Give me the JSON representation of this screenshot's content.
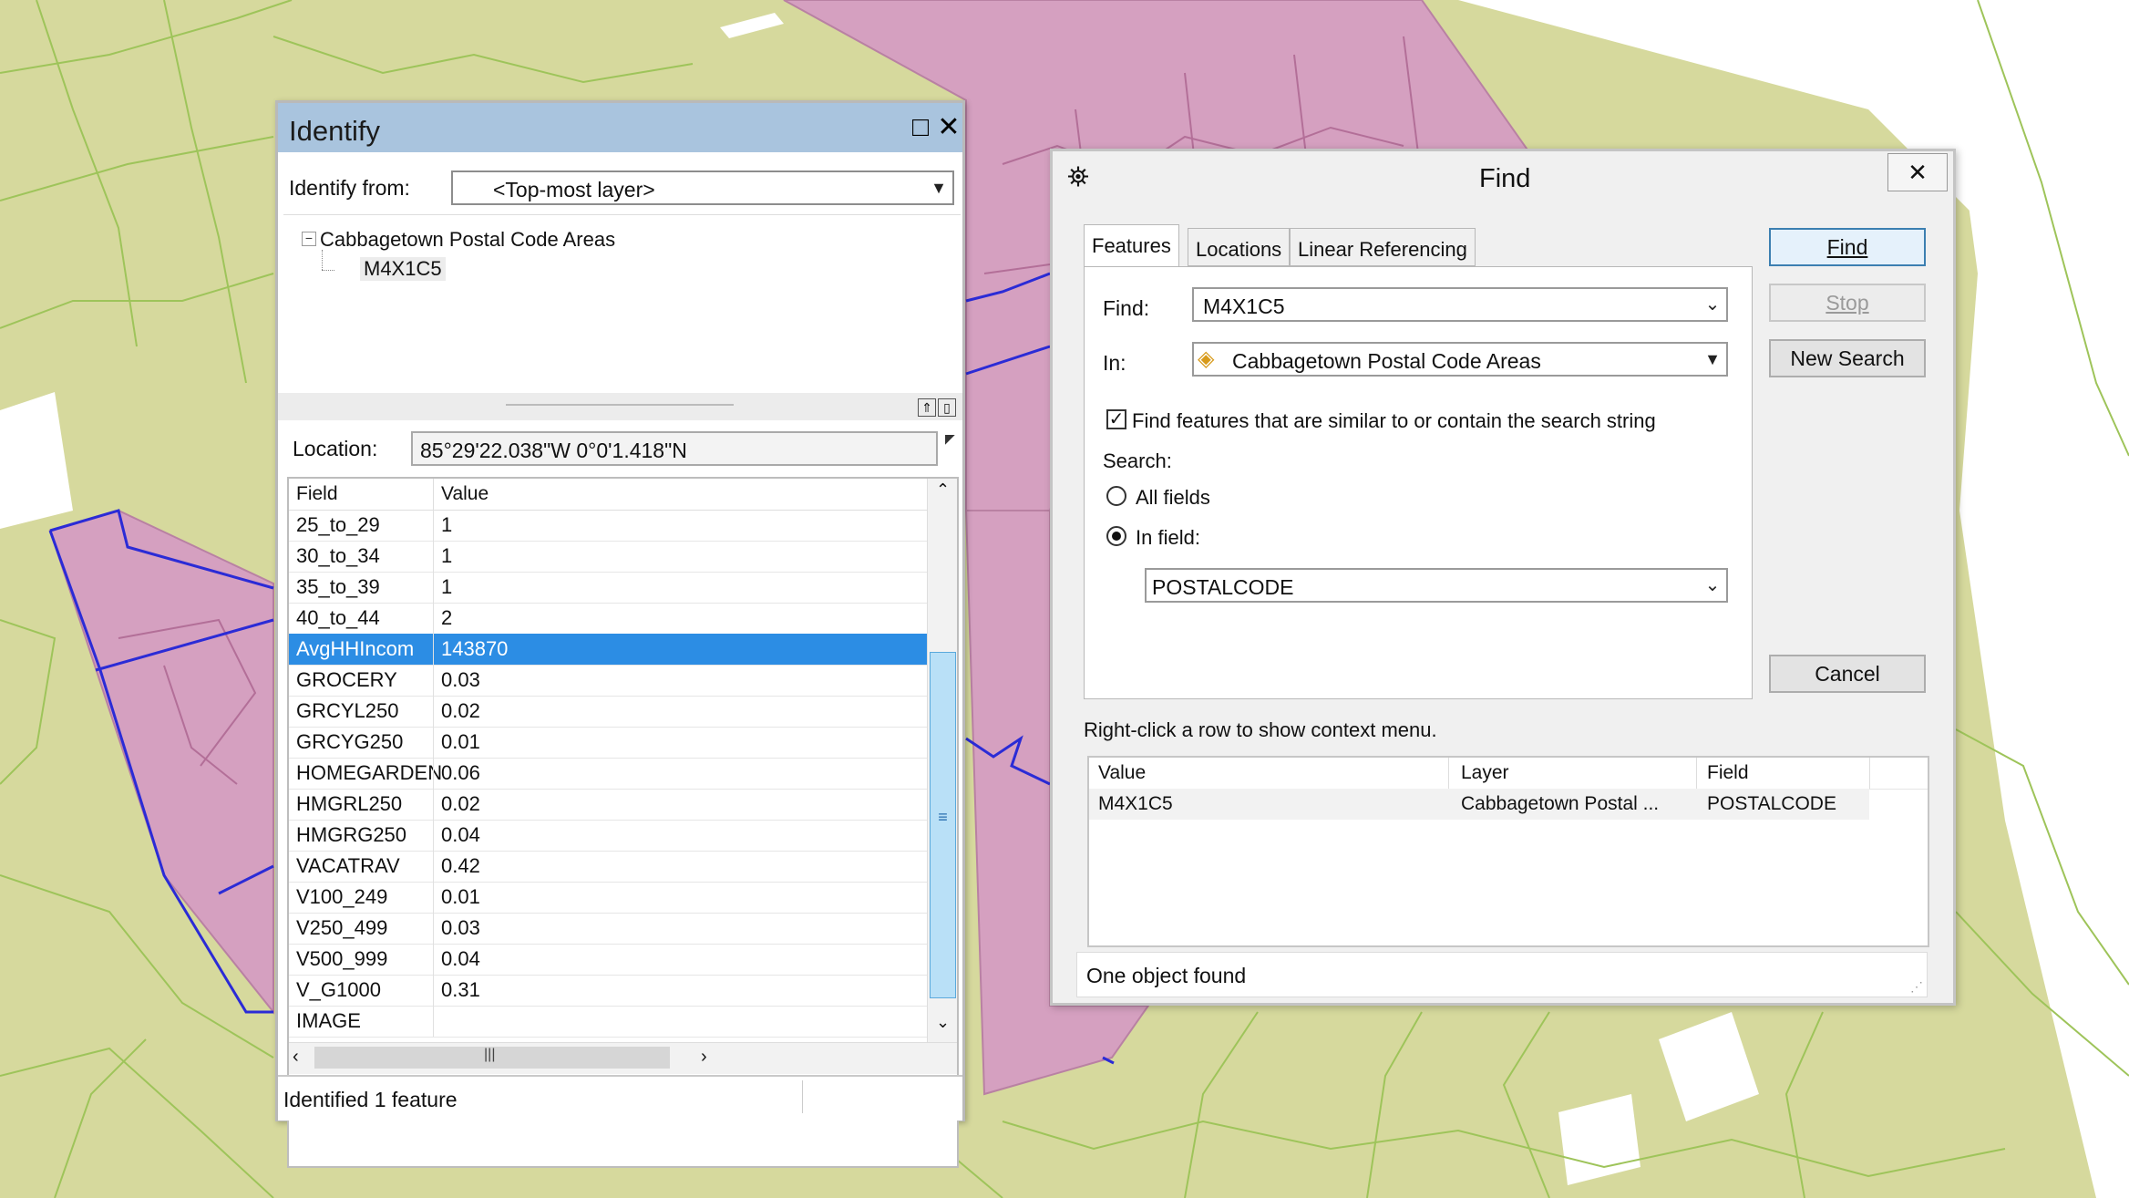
{
  "colors": {
    "map_bg": "#d6d99d",
    "map_lines": "#9ec45a",
    "pink": "#d5a0c0",
    "selection": "#2c8de4",
    "title_blue": "#a9c4de"
  },
  "identify": {
    "title": "Identify",
    "identify_from_label": "Identify from:",
    "identify_from_value": "<Top-most layer>",
    "tree": {
      "layer": "Cabbagetown Postal Code Areas",
      "feature": "M4X1C5"
    },
    "location_label": "Location:",
    "location_value": "85°29'22.038\"W  0°0'1.418\"N",
    "columns": [
      "Field",
      "Value"
    ],
    "rows": [
      {
        "field": "25_to_29",
        "value": "1"
      },
      {
        "field": "30_to_34",
        "value": "1"
      },
      {
        "field": "35_to_39",
        "value": "1"
      },
      {
        "field": "40_to_44",
        "value": "2"
      },
      {
        "field": "AvgHHIncom",
        "value": "143870",
        "selected": true
      },
      {
        "field": "GROCERY",
        "value": "0.03"
      },
      {
        "field": "GRCYL250",
        "value": "0.02"
      },
      {
        "field": "GRCYG250",
        "value": "0.01"
      },
      {
        "field": "HOMEGARDEN",
        "value": "0.06"
      },
      {
        "field": "HMGRL250",
        "value": "0.02"
      },
      {
        "field": "HMGRG250",
        "value": "0.04"
      },
      {
        "field": "VACATRAV",
        "value": "0.42"
      },
      {
        "field": "V100_249",
        "value": "0.01"
      },
      {
        "field": "V250_499",
        "value": "0.03"
      },
      {
        "field": "V500_999",
        "value": "0.04"
      },
      {
        "field": "V_G1000",
        "value": "0.31"
      },
      {
        "field": "IMAGE",
        "value": ""
      }
    ],
    "status": "Identified 1 feature"
  },
  "find": {
    "title": "Find",
    "tabs": [
      "Features",
      "Locations",
      "Linear Referencing"
    ],
    "find_label": "Find:",
    "find_value": "M4X1C5",
    "in_label": "In:",
    "in_value": "Cabbagetown Postal Code Areas",
    "similar_label": "Find features that are similar to or contain the search string",
    "search_label": "Search:",
    "all_fields_label": "All fields",
    "in_field_label": "In field:",
    "in_field_value": "POSTALCODE",
    "buttons": {
      "find": "Find",
      "stop": "Stop",
      "new_search": "New Search",
      "cancel": "Cancel"
    },
    "hint": "Right-click a row to show context menu.",
    "result_columns": [
      "Value",
      "Layer",
      "Field"
    ],
    "result_row": {
      "value": "M4X1C5",
      "layer": "Cabbagetown Postal ...",
      "field": "POSTALCODE"
    },
    "status": "One object found"
  }
}
